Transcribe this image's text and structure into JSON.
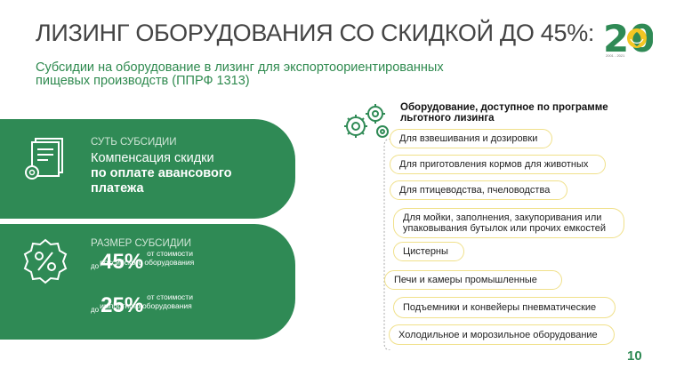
{
  "title": "ЛИЗИНГ ОБОРУДОВАНИЯ СО СКИДКОЙ ДО 45%:",
  "subtitle": "Субсидии на оборудование в лизинг для экспортоориентированных пищевых производств (ППРФ 1313)",
  "logo": {
    "number": "20",
    "years": "2001 - 2021"
  },
  "essence": {
    "label": "СУТЬ СУБСИДИИ",
    "line1": "Компенсация скидки",
    "line2": "по оплате авансового",
    "line3": "платежа"
  },
  "size": {
    "label": "РАЗМЕР СУБСИДИИ",
    "rows": [
      {
        "prefix": "до",
        "value": "45%",
        "desc1": "от стоимости",
        "desc2": "российского оборудования"
      },
      {
        "prefix": "до",
        "value": "25%",
        "desc1": "от стоимости",
        "desc2": "импортного оборудования"
      }
    ]
  },
  "equipment": {
    "title": "Оборудование, доступное по программе льготного лизинга",
    "items": [
      "Для взвешивания и дозировки",
      "Для приготовления кормов для животных",
      "Для птицеводства, пчеловодства",
      "Для мойки, заполнения, закупоривания или упаковывания бутылок или прочих емкостей",
      "Цистерны",
      "Печи и камеры промышленные",
      "Подъемники и конвейеры пневматические",
      "Холодильное и морозильное оборудование"
    ]
  },
  "page_number": "10",
  "colors": {
    "green": "#2f8a55",
    "pill_border": "#f0e08a",
    "title": "#444444"
  }
}
